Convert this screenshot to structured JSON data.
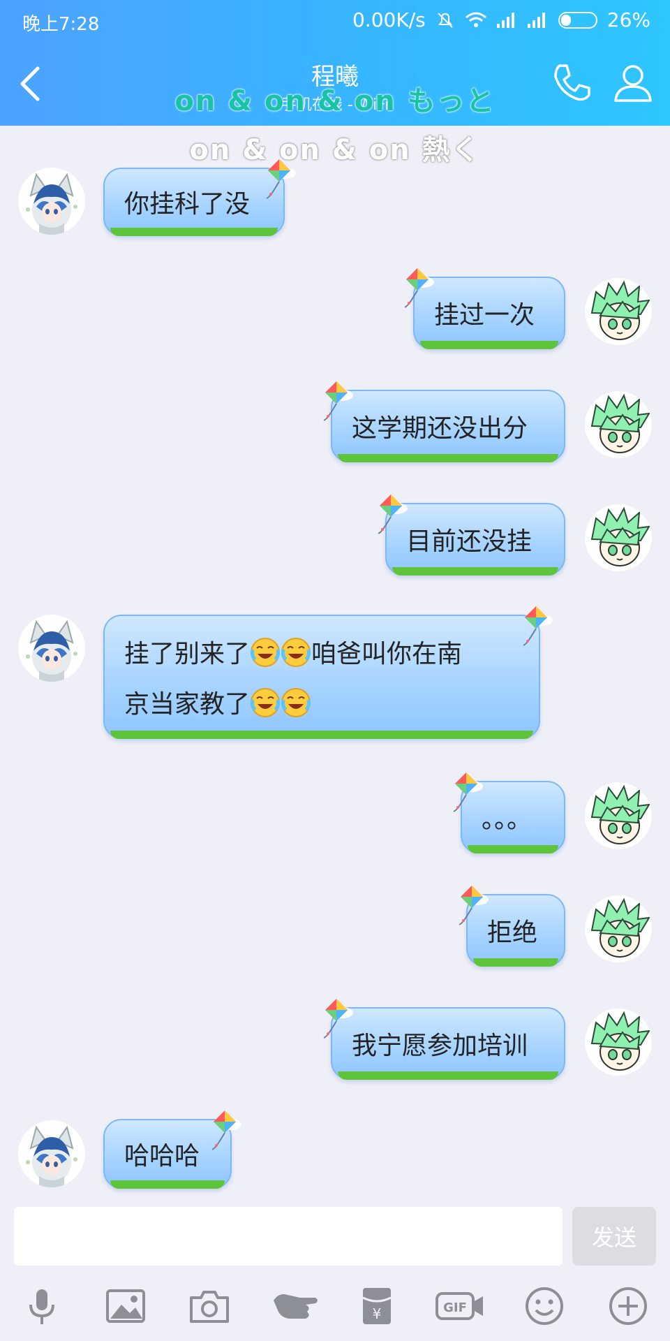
{
  "status_bar": {
    "time": "晚上7:28",
    "network_speed": "0.00K/s",
    "battery": "26%"
  },
  "header": {
    "contact_name": "程曦",
    "contact_status": "手机在线 - WiFi",
    "lyric_line1": "on & on & on もっと",
    "lyric_line2": "on & on & on 熱く"
  },
  "messages": [
    {
      "side": "in",
      "text": "你挂科了没"
    },
    {
      "side": "out",
      "text": "挂过一次"
    },
    {
      "side": "out",
      "text": "这学期还没出分"
    },
    {
      "side": "out",
      "text": "目前还没挂"
    },
    {
      "side": "in",
      "text_line1": "挂了别来了",
      "text_line1_tail": "咱爸叫你在南",
      "text_line2": "京当家教了"
    },
    {
      "side": "out",
      "text": "。。。"
    },
    {
      "side": "out",
      "text": "拒绝"
    },
    {
      "side": "out",
      "text": "我宁愿参加培训"
    },
    {
      "side": "in",
      "text": "哈哈哈"
    }
  ],
  "composer": {
    "input_value": "",
    "send_label": "发送"
  },
  "toolbar": [
    "mic-icon",
    "image-icon",
    "camera-icon",
    "hand-icon",
    "red-packet-icon",
    "gif-icon",
    "emoji-icon",
    "plus-icon"
  ],
  "colors": {
    "header_start": "#4da2ff",
    "header_end": "#2ec6ff",
    "bubble": "#a8d4ff",
    "grass": "#5ec43c",
    "background": "#eff0f7"
  }
}
